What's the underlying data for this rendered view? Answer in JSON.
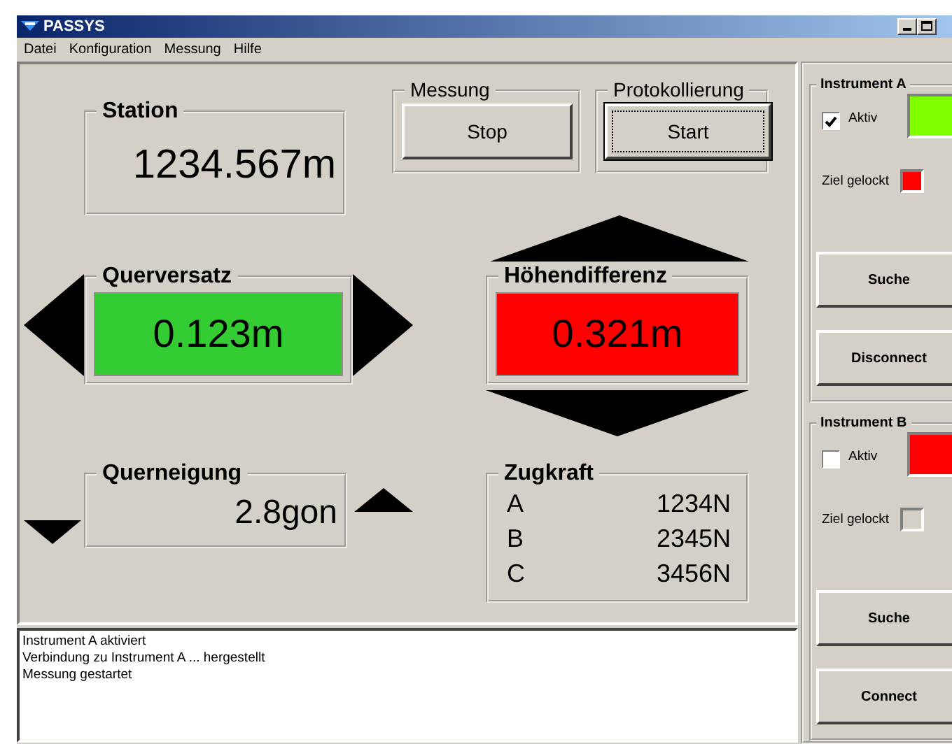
{
  "window": {
    "title": "PASSYS"
  },
  "menu": [
    "Datei",
    "Konfiguration",
    "Messung",
    "Hilfe"
  ],
  "station": {
    "label": "Station",
    "value": "1234.567m"
  },
  "messung": {
    "label": "Messung",
    "button": "Stop",
    "focused": false
  },
  "protokollierung": {
    "label": "Protokollierung",
    "button": "Start",
    "focused": true
  },
  "deviations": [
    {
      "kind": "horizontal",
      "label": "Querversatz",
      "value": "0.123m",
      "color": "#33cc33"
    },
    {
      "kind": "vertical",
      "label": "Höhendifferenz",
      "value": "0.321m",
      "color": "#ff0000"
    }
  ],
  "querneigung": {
    "label": "Querneigung",
    "value": "2.8gon"
  },
  "zugkraft": {
    "label": "Zugkraft",
    "rows": [
      {
        "name": "A",
        "value": "1234N"
      },
      {
        "name": "B",
        "value": "2345N"
      },
      {
        "name": "C",
        "value": "3456N"
      }
    ]
  },
  "log": [
    "Instrument A aktiviert",
    "Verbindung zu Instrument A ... hergestellt",
    "Messung gestartet"
  ],
  "instruments": [
    {
      "label": "Instrument A",
      "active_label": "Aktiv",
      "checked": true,
      "color": "#80ff00",
      "lock_label": "Ziel gelockt",
      "locked": true,
      "buttons": [
        "Suche",
        "Disconnect"
      ]
    },
    {
      "label": "Instrument B",
      "active_label": "Aktiv",
      "checked": false,
      "color": "#ff0000",
      "lock_label": "Ziel gelockt",
      "locked": false,
      "buttons": [
        "Suche",
        "Connect"
      ]
    }
  ]
}
